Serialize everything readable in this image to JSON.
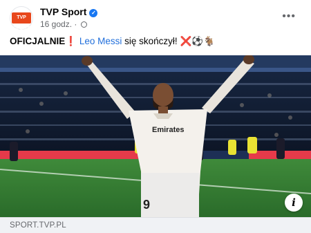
{
  "post": {
    "page_name": "TVP Sport",
    "avatar_text": "TVP SPORT",
    "time": "16 godz.",
    "text_bold": "OFICJALNIE",
    "emoji_exclaim": "❗",
    "text_link": "Leo Messi",
    "text_rest": "się skończył!",
    "emoji_tail": "❌⚽🐐"
  },
  "photo": {
    "jersey_text": "Emirates",
    "jersey_number": "9"
  },
  "link_preview": {
    "domain": "SPORT.TVP.PL"
  },
  "icons": {
    "verified": "verified-badge-icon",
    "globe": "globe-icon",
    "more": "more-options-icon",
    "info": "info-icon"
  },
  "colors": {
    "link": "#216fdb",
    "verified": "#1877f2",
    "brand": "#e8471c",
    "footer_bg": "#f0f2f5"
  }
}
